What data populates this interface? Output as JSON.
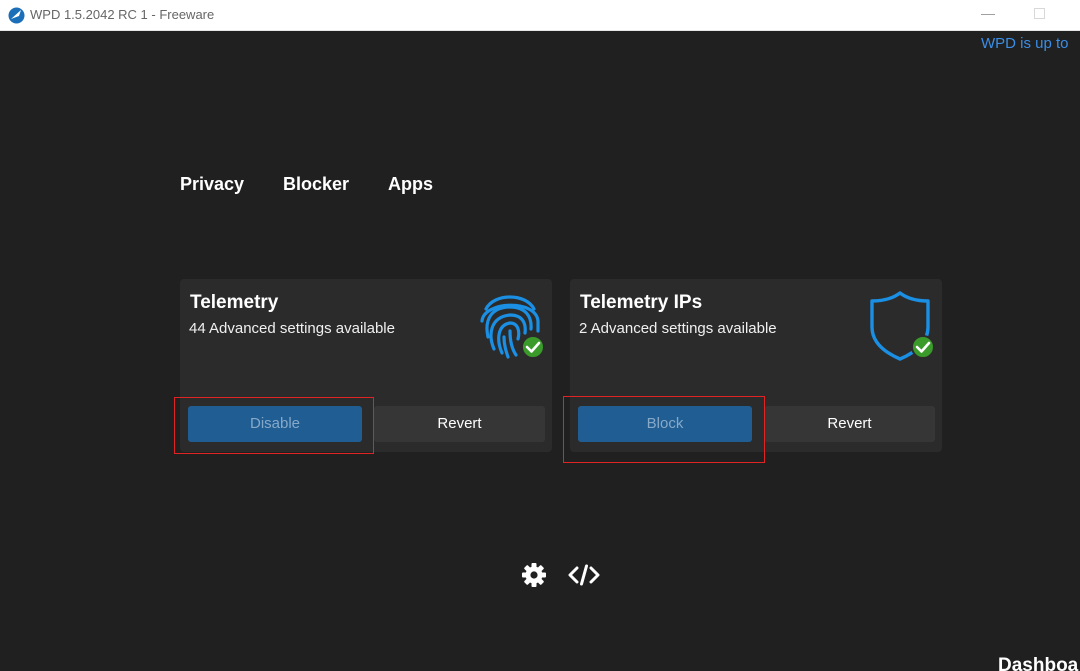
{
  "window": {
    "title": "WPD 1.5.2042 RC 1 - Freeware",
    "minimize_glyph": "—",
    "icons": {
      "app": "wpd-logo-icon",
      "minimize": "minimize-icon",
      "maximize": "maximize-icon"
    }
  },
  "header": {
    "update_status": "WPD is up to"
  },
  "nav": {
    "tabs": [
      {
        "label": "Privacy"
      },
      {
        "label": "Blocker"
      },
      {
        "label": "Apps"
      }
    ]
  },
  "cards": [
    {
      "title": "Telemetry",
      "subtitle": "44 Advanced settings available",
      "icon": "fingerprint-check-icon",
      "primary_label": "Disable",
      "secondary_label": "Revert"
    },
    {
      "title": "Telemetry IPs",
      "subtitle": "2 Advanced settings available",
      "icon": "shield-check-icon",
      "primary_label": "Block",
      "secondary_label": "Revert"
    }
  ],
  "footer": {
    "icons": [
      "gear-icon",
      "code-icon"
    ],
    "dashboard_label": "Dashboa"
  },
  "colors": {
    "background": "#202020",
    "card": "#2b2b2b",
    "accent": "#1a8fe3",
    "primary_button": "#1f5d93",
    "check_badge": "#3a9a2a",
    "highlight_box": "#e02424",
    "link": "#3a8ee6"
  }
}
